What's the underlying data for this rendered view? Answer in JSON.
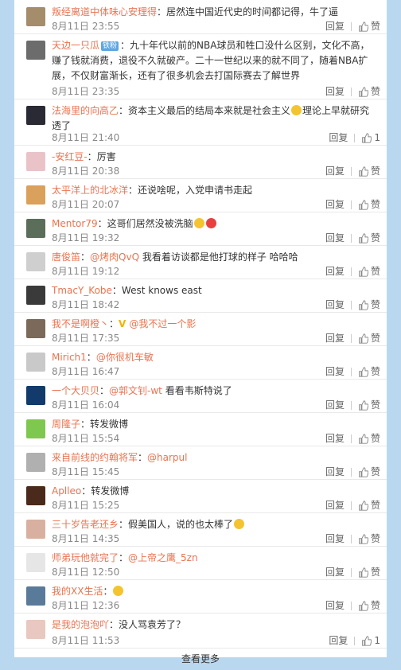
{
  "comments": [
    {
      "user": "叛经离道中体味心安理得",
      "verified": false,
      "text": "：居然连中国近代史的时间都记得，牛了逼",
      "time": "8月11日 23:55",
      "reply": "回复",
      "like": "赞",
      "avatar_color": "#a58c6a"
    },
    {
      "user": "天边一只瓜",
      "verified": true,
      "badge": "铁粉",
      "text": "：九十年代以前的NBA球员和牲口没什么区别，文化不高，赚了钱就消费，退役不久就破产。二十一世纪以来的就不同了，随着NBA扩展，不仅财富渐长，还有了很多机会去打国际赛去了解世界",
      "time": "8月11日 23:35",
      "reply": "回复",
      "like": "赞",
      "avatar_color": "#6c6c6c"
    },
    {
      "user": "法海里的向高乙",
      "verified": false,
      "text": "：资本主义最后的结局本来就是社会主义",
      "emoji_mid": true,
      "text2": "理论上早就研究透了",
      "time": "8月11日 21:40",
      "reply": "回复",
      "like": "1",
      "avatar_color": "#2a2a35"
    },
    {
      "user": "-安红豆-",
      "verified": false,
      "text": "：厉害",
      "time": "8月11日 20:38",
      "reply": "回复",
      "like": "赞",
      "avatar_color": "#e9c3c8"
    },
    {
      "user": "太平洋上的北冰洋",
      "verified": false,
      "text": "：还说啥呢，入党申请书走起",
      "time": "8月11日 20:07",
      "reply": "回复",
      "like": "赞",
      "avatar_color": "#d9a15b"
    },
    {
      "user": "Mentor79",
      "verified": false,
      "text": "：这哥们居然没被洗脑",
      "emoji_end": 2,
      "time": "8月11日 19:32",
      "reply": "回复",
      "like": "赞",
      "avatar_color": "#5a6e5a"
    },
    {
      "user": "唐俊笛",
      "verified": false,
      "at": "@烤肉QvQ",
      "text": "我看着访谈都是他打球的样子 哈哈哈",
      "time": "8月11日 19:12",
      "reply": "回复",
      "like": "赞",
      "avatar_color": "#cfcfcf"
    },
    {
      "user": "TmacY_Kobe",
      "verified": false,
      "text": "：West knows east",
      "time": "8月11日 18:42",
      "reply": "回复",
      "like": "赞",
      "avatar_color": "#3a3a3a"
    },
    {
      "user": "我不是啊橙丶",
      "verified": false,
      "badge2": "V",
      "at": "@我不过一个影",
      "text": "",
      "time": "8月11日 17:35",
      "reply": "回复",
      "like": "赞",
      "avatar_color": "#7b6a5a"
    },
    {
      "user": "Mirich1",
      "verified": false,
      "at": "@你很机车敏",
      "text": "",
      "time": "8月11日 16:47",
      "reply": "回复",
      "like": "赞",
      "avatar_color": "#c9c9c9"
    },
    {
      "user": "一个大贝贝",
      "verified": false,
      "at": "@郭文钊-wt",
      "text": "看看韦斯特说了",
      "time": "8月11日 16:04",
      "reply": "回复",
      "like": "赞",
      "avatar_color": "#123a6a"
    },
    {
      "user": "周隆子",
      "verified": false,
      "text": "：转发微博",
      "time": "8月11日 15:54",
      "reply": "回复",
      "like": "赞",
      "avatar_color": "#7ec850"
    },
    {
      "user": "来自前线的约翰将军",
      "verified": false,
      "at": "@harpul",
      "text": "",
      "time": "8月11日 15:45",
      "reply": "回复",
      "like": "赞",
      "avatar_color": "#b0b0b0"
    },
    {
      "user": "Aplleo",
      "verified": false,
      "text": "：转发微博",
      "time": "8月11日 15:25",
      "reply": "回复",
      "like": "赞",
      "avatar_color": "#4a2a1a"
    },
    {
      "user": "三十岁告老还乡",
      "verified": false,
      "text": "：假美国人，说的也太棒了",
      "emoji_end": 1,
      "time": "8月11日 14:35",
      "reply": "回复",
      "like": "赞",
      "avatar_color": "#d8b0a0"
    },
    {
      "user": "师弟玩他就完了",
      "verified": false,
      "at": "@上帝之鹰_5zn",
      "text": "",
      "time": "8月11日 12:50",
      "reply": "回复",
      "like": "赞",
      "avatar_color": "#e6e6e6"
    },
    {
      "user": "我的XX生活",
      "verified": false,
      "text": "：",
      "emoji_end": 1,
      "time": "8月11日 12:36",
      "reply": "回复",
      "like": "赞",
      "avatar_color": "#5a7a9a"
    },
    {
      "user": "是我的泡泡吖",
      "verified": false,
      "text": "：没人骂袁芳了？",
      "time": "8月11日 11:53",
      "reply": "回复",
      "like": "1",
      "avatar_color": "#e8c8c0"
    }
  ],
  "more_label": "查看更多"
}
